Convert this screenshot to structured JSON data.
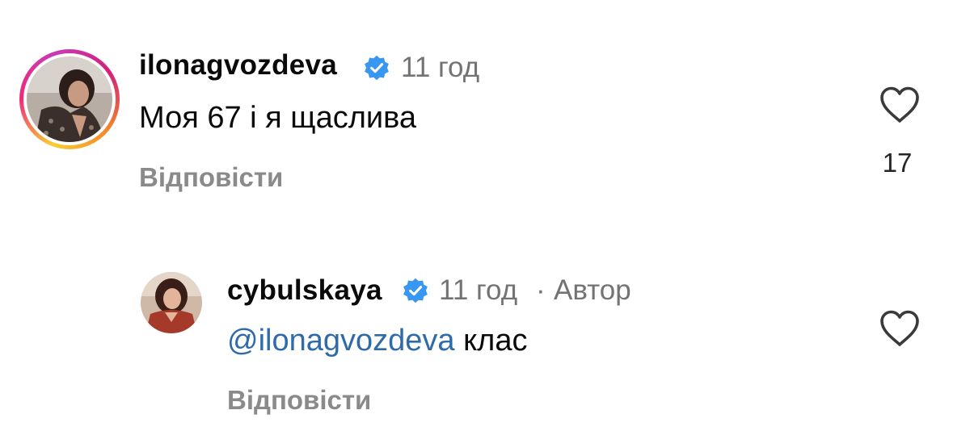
{
  "comments": [
    {
      "username": "ilonagvozdeva",
      "time": "11 год",
      "text": "Моя 67 і я щаслива",
      "reply_label": "Відповісти",
      "likes": "17",
      "verified": true,
      "avatar_has_story_ring": true
    },
    {
      "username": "cybulskaya",
      "time": "11 год",
      "separator": "·",
      "author_badge": "Автор",
      "mention": "@ilonagvozdeva",
      "text": "клас",
      "reply_label": "Відповісти",
      "verified": true
    }
  ],
  "icons": {
    "verified": "verified-badge-icon",
    "like": "heart-outline-icon"
  },
  "colors": {
    "verified_blue": "#3897f0",
    "mention_blue": "#2f6ba8",
    "meta_gray": "#737373",
    "reply_gray": "#8a8a8a"
  }
}
